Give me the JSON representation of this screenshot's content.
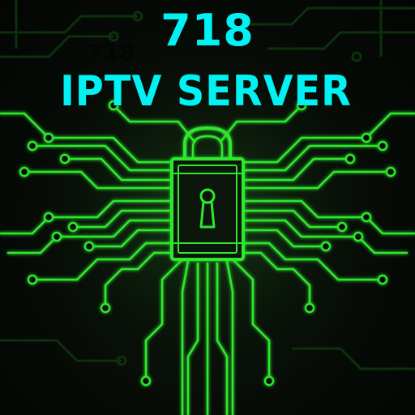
{
  "title": {
    "number": "718",
    "text": "IPTV SERVER",
    "ghost_number": "718"
  },
  "colors": {
    "title": "#00f2f2",
    "circuit": "#2fe82f",
    "background": "#050805"
  },
  "artwork": {
    "graphic": "circuit-board-padlock",
    "icon": "padlock-icon"
  }
}
